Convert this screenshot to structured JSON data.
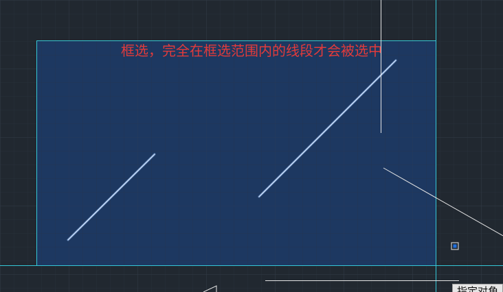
{
  "app": {
    "background_color": "#212830",
    "grid_color": "#2c343e",
    "selection_fill_color": "#1d3a66",
    "selection_border_color": "#35c8d8",
    "selected_line_color": "#9fc6ff",
    "unselected_line_color": "#e6e6e6",
    "grip_color": "#1f6fe0"
  },
  "annotation": {
    "text": "框选，完全在框选范围内的线段才会被选中",
    "color": "#e23b3b"
  },
  "tooltip": {
    "text": "指定对角"
  }
}
